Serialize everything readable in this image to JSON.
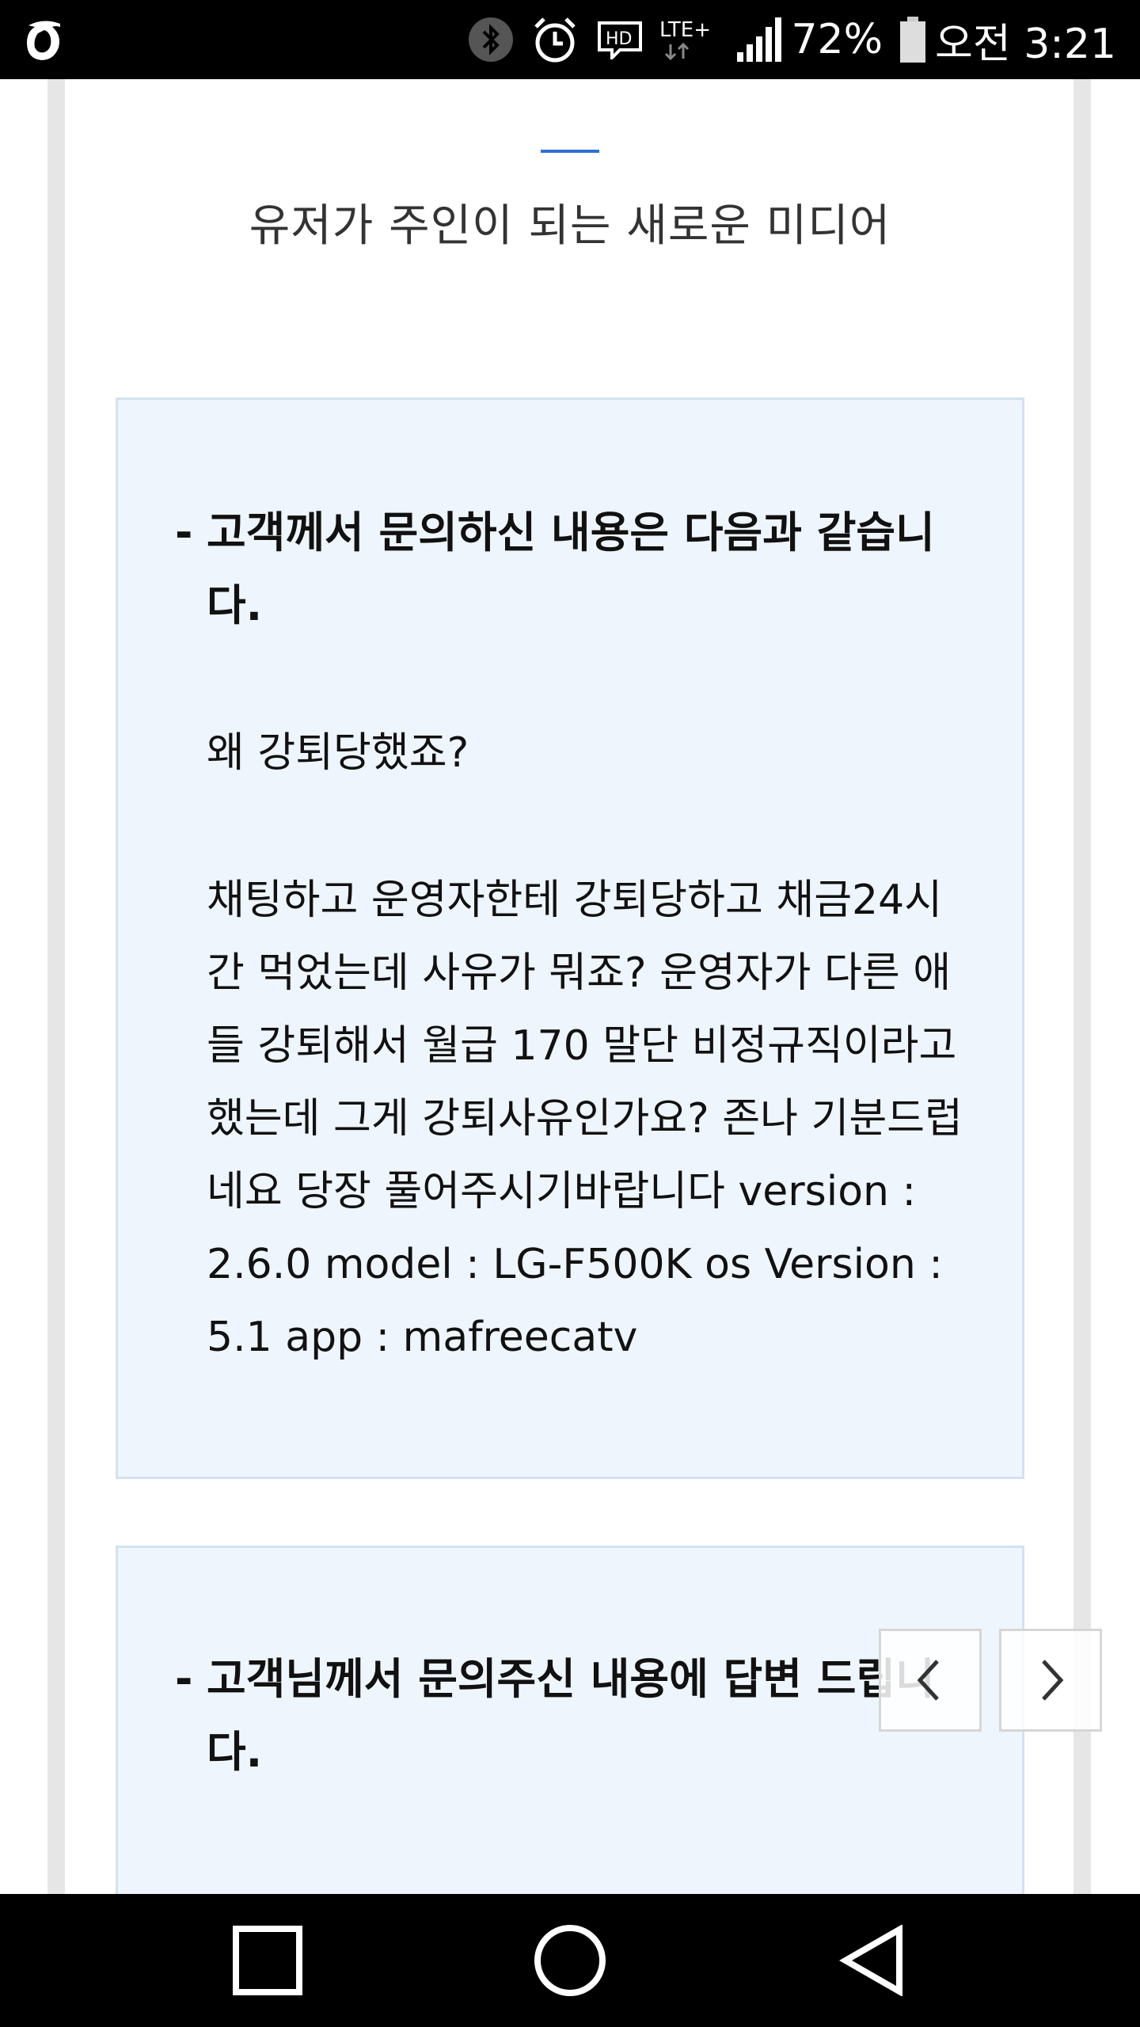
{
  "status_bar": {
    "battery_percent": "72%",
    "time": "오전 3:21",
    "network": "LTE+",
    "hd_label": "HD",
    "icons": [
      "app-logo-icon",
      "bluetooth-icon",
      "alarm-icon",
      "hd-voice-icon",
      "lte-icon",
      "signal-icon",
      "battery-icon"
    ]
  },
  "page": {
    "tagline": "유저가 주인이 되는 새로운 미디어",
    "accent_color": "#2f6fd6"
  },
  "inquiry_card": {
    "dash": "-",
    "heading": "고객께서 문의하신 내용은 다음과 같습니다.",
    "subject": "왜 강퇴당했죠?",
    "body": "채팅하고 운영자한테 강퇴당하고 채금24시간 먹었는데 사유가 뭐죠? 운영자가 다른 애들 강퇴해서 월급 170 말단 비정규직이라고 했는데 그게 강퇴사유인가요? 존나 기분드럽네요 당장 풀어주시기바랍니다 version : 2.6.0 model : LG-F500K os Version : 5.1 app : mafreecatv"
  },
  "answer_card": {
    "dash": "-",
    "heading": "고객님께서 문의주신 내용에 답변 드립니다."
  },
  "pager": {
    "prev_icon": "chevron-left-icon",
    "next_icon": "chevron-right-icon"
  },
  "nav_bar": {
    "icons": [
      "recent-apps-icon",
      "home-icon",
      "back-icon"
    ]
  }
}
